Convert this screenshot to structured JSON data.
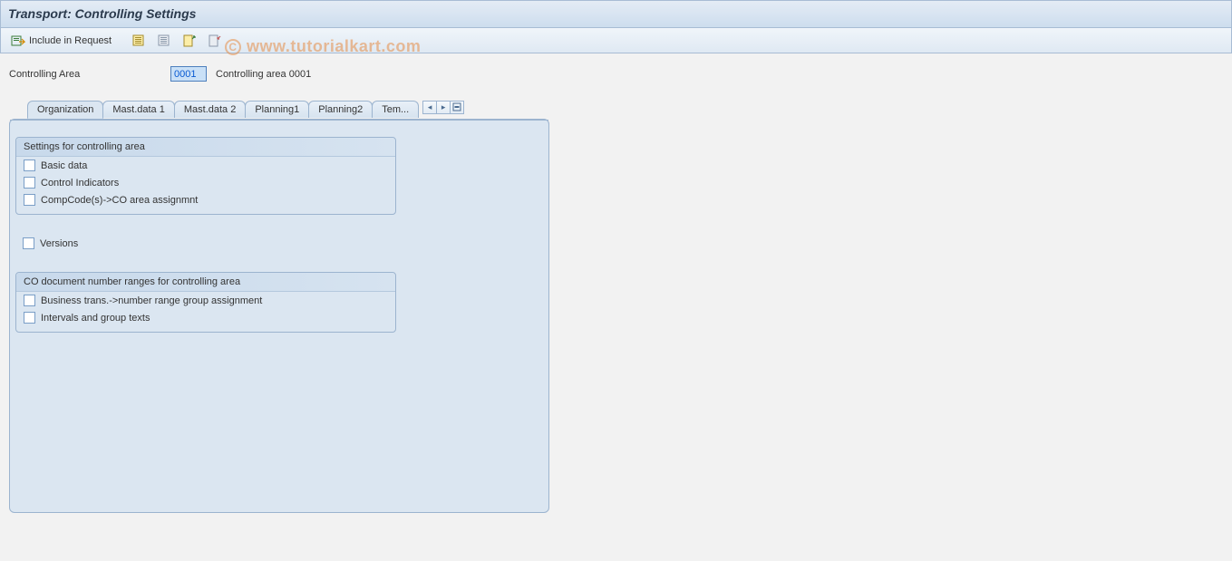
{
  "title": "Transport: Controlling Settings",
  "toolbar": {
    "include_label": "Include in Request"
  },
  "field": {
    "label": "Controlling Area",
    "value": "0001",
    "desc": "Controlling area 0001"
  },
  "tabs": [
    {
      "label": "Organization"
    },
    {
      "label": "Mast.data 1"
    },
    {
      "label": "Mast.data 2"
    },
    {
      "label": "Planning1"
    },
    {
      "label": "Planning2"
    },
    {
      "label": "Tem..."
    }
  ],
  "group1": {
    "title": "Settings for controlling area",
    "items": [
      "Basic data",
      "Control Indicators",
      "CompCode(s)->CO area assignmnt"
    ]
  },
  "standalone": {
    "versions": "Versions"
  },
  "group2": {
    "title": "CO document number ranges for controlling area",
    "items": [
      "Business trans.->number range group assignment",
      "Intervals and group texts"
    ]
  },
  "watermark": "www.tutorialkart.com"
}
